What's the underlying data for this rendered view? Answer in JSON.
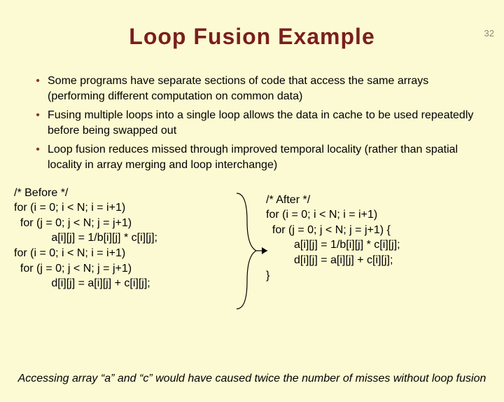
{
  "page_number": "32",
  "title": "Loop Fusion Example",
  "bullets": [
    "Some programs have separate sections of code that access the same arrays (performing different computation on common data)",
    "Fusing multiple loops into a single loop allows the data in cache to be used repeatedly before being swapped out",
    "Loop fusion reduces missed through improved temporal locality (rather than spatial locality in array merging and loop interchange)"
  ],
  "code_before": {
    "l1": "/* Before */",
    "l2": "for (i = 0; i < N; i = i+1)",
    "l3": "  for (j = 0; j < N; j = j+1)",
    "l4": "            a[i][j] = 1/b[i][j] * c[i][j];",
    "l5": "for (i = 0; i < N; i = i+1)",
    "l6": "  for (j = 0; j < N; j = j+1)",
    "l7": "            d[i][j] = a[i][j] + c[i][j];"
  },
  "code_after": {
    "l1": "/* After */",
    "l2": "for (i = 0; i < N; i = i+1)",
    "l3": "  for (j = 0; j < N; j = j+1) {",
    "l4": "         a[i][j] = 1/b[i][j] * c[i][j];",
    "l5": "         d[i][j] = a[i][j] + c[i][j];",
    "l6": "}"
  },
  "footnote": "Accessing array “a” and “c” would have caused twice the number of misses without loop fusion"
}
